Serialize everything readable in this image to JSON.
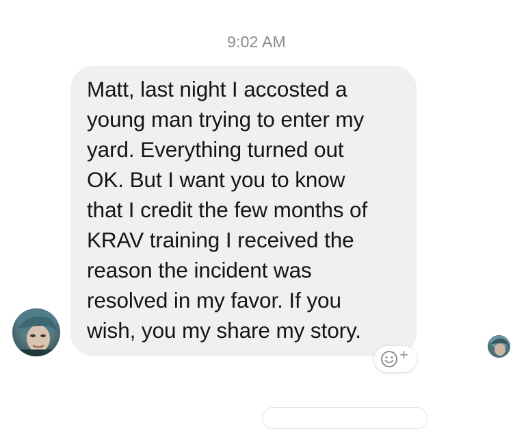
{
  "conversation": {
    "timestamp": "9:02 AM"
  },
  "message": {
    "text": "Matt, last night I accosted a\nyoung man trying to enter my\nyard. Everything turned out\nOK. But I want you to know\nthat I credit the few months of\nKRAV training I received the\nreason the incident was\nresolved in my favor. If you\nwish, you my share my story.",
    "bubble_color": "#f1f0f0"
  },
  "reaction": {
    "icon": "smiley-add-icon",
    "plus": "+"
  },
  "colors": {
    "timestamp": "#8a8a8e",
    "text": "#141414",
    "background": "#ffffff"
  }
}
